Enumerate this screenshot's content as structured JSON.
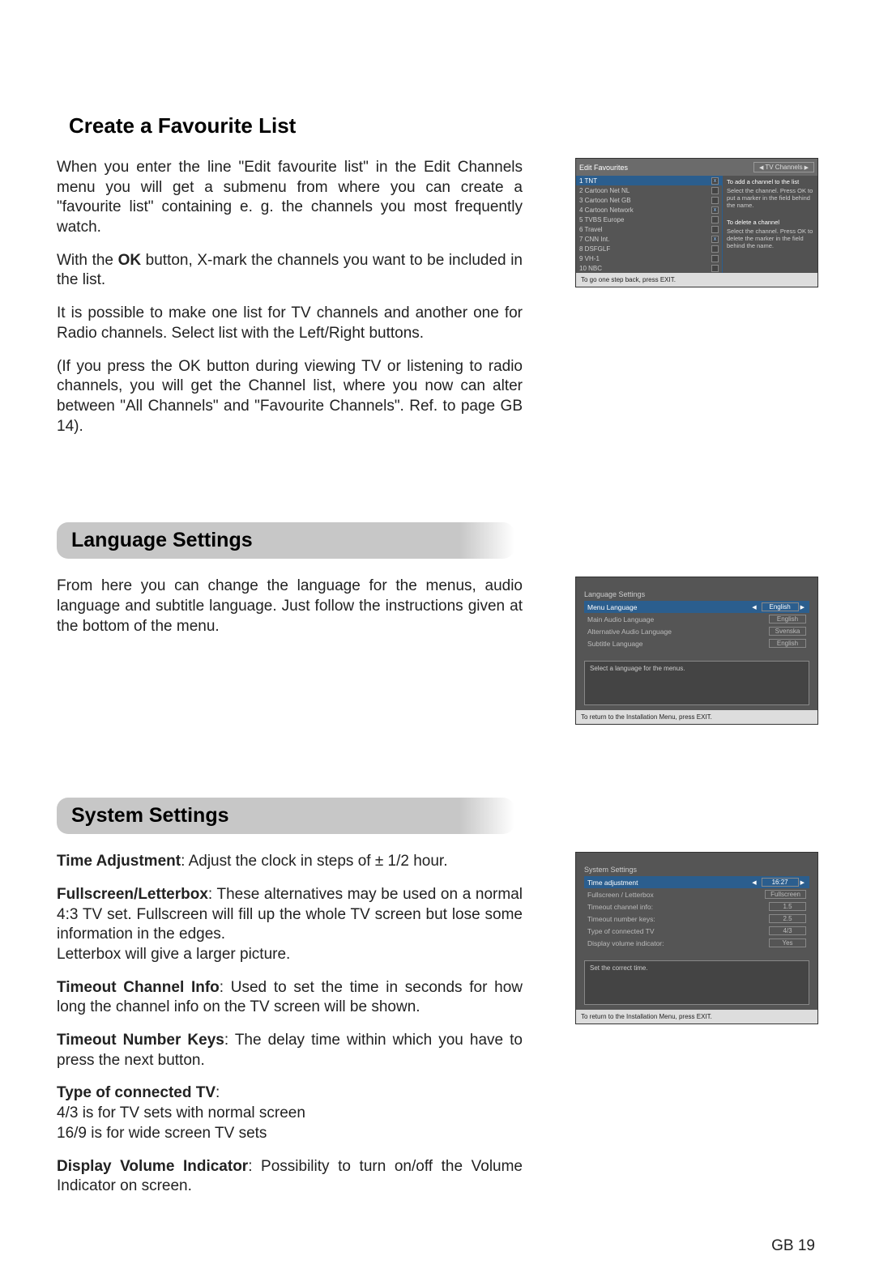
{
  "section1": {
    "title": "Create a Favourite List",
    "p1": "When you enter the line \"Edit favourite list\" in the Edit Channels menu you will get a submenu from where you can create a \"favourite list\" containing e. g. the channels you most frequently watch.",
    "p2a": "With the ",
    "p2b": "OK",
    "p2c": " button, X-mark the channels you want to be included in the list.",
    "p3": "It is possible to make one list for TV channels and another one for Radio channels. Select list with the Left/Right buttons.",
    "p4": "(If you press the OK button during viewing TV or listening to radio channels, you will get the Channel list, where you now can alter between \"All Channels\" and \"Favourite Channels\". Ref. to page GB 14).",
    "osd": {
      "header_left": "Edit Favourites",
      "header_spin": "TV Channels",
      "rows": [
        {
          "name": "1 TNT",
          "chk": true,
          "hl": true
        },
        {
          "name": "2 Cartoon Net NL",
          "chk": false
        },
        {
          "name": "3 Cartoon Net GB",
          "chk": false
        },
        {
          "name": "4 Cartoon Network",
          "chk": true
        },
        {
          "name": "5 TVBS Europe",
          "chk": false
        },
        {
          "name": "6 Travel",
          "chk": false
        },
        {
          "name": "7 CNN Int.",
          "chk": true
        },
        {
          "name": "8 DSFGLF",
          "chk": false
        },
        {
          "name": "9 VH-1",
          "chk": false
        },
        {
          "name": "10 NBC",
          "chk": false
        }
      ],
      "right_add_title": "To add a channel to the list",
      "right_add_body": "Select the channel.\nPress OK to put a marker in the field behind the name.",
      "right_del_title": "To delete a channel",
      "right_del_body": "Select the channel.\nPress OK to delete the marker in the field behind the name.",
      "footer": "To go one step back, press EXIT."
    }
  },
  "section2": {
    "title": "Language Settings",
    "p1": "From here you can change the language for the menus, audio language and subtitle language. Just follow the instructions given at the bottom of the menu.",
    "osd": {
      "title": "Language Settings",
      "rows": [
        {
          "lbl": "Menu Language",
          "val": "English",
          "hl": true
        },
        {
          "lbl": "Main Audio Language",
          "val": "English"
        },
        {
          "lbl": "Alternative Audio Language",
          "val": "Svenska"
        },
        {
          "lbl": "Subtitle Language",
          "val": "English"
        }
      ],
      "help": "Select a language for the menus.",
      "footer": "To return to the Installation Menu, press EXIT."
    }
  },
  "section3": {
    "title": "System Settings",
    "p1a": "Time Adjustment",
    "p1b": ": Adjust the clock in steps of ± 1/2 hour.",
    "p2a": "Fullscreen/Letterbox",
    "p2b": ":  These alternatives may be used on a normal 4:3 TV set. Fullscreen will fill up the whole TV screen but lose some information in the edges.",
    "p2c": "Letterbox will give a larger picture.",
    "p3a": "Timeout Channel Info",
    "p3b": ": Used to set the time in seconds for how long the channel info on the TV screen will be shown.",
    "p4a": "Timeout Number Keys",
    "p4b": ": The delay time within which you have to press the next button.",
    "p5a": "Type of connected TV",
    "p5colon": ":",
    "p5b": "4/3 is for TV sets with normal screen",
    "p5c": "16/9 is for wide screen TV sets",
    "p6a": "Display Volume Indicator",
    "p6b": ": Possibility to turn on/off the Volume Indicator on screen.",
    "osd": {
      "title": "System Settings",
      "rows": [
        {
          "lbl": "Time adjustment",
          "val": "16:27",
          "hl": true
        },
        {
          "lbl": "Fullscreen / Letterbox",
          "val": "Fullscreen"
        },
        {
          "lbl": "Timeout channel info:",
          "val": "1.5"
        },
        {
          "lbl": "Timeout number keys:",
          "val": "2.5"
        },
        {
          "lbl": "Type of connected TV",
          "val": "4/3"
        },
        {
          "lbl": "Display volume indicator:",
          "val": "Yes"
        }
      ],
      "help": "Set the correct time.",
      "footer": "To return to the Installation Menu, press EXIT."
    }
  },
  "page_number": "GB 19"
}
